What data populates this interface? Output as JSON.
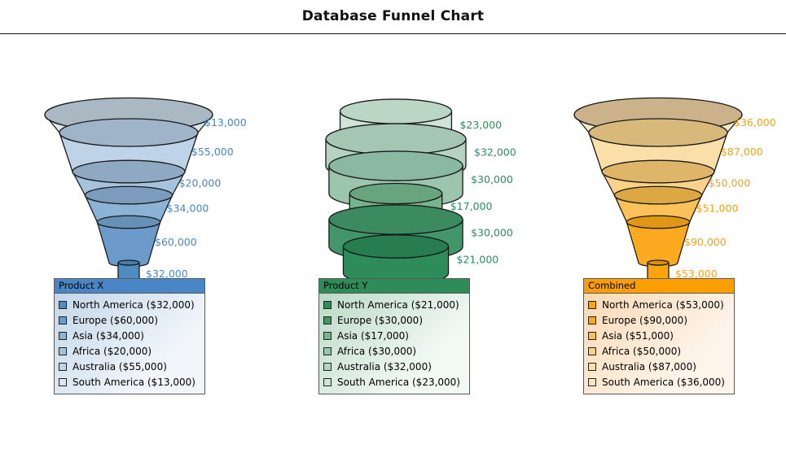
{
  "title": "Database Funnel Chart",
  "chart_data": [
    {
      "type": "funnel",
      "title": "Product X",
      "style": "cone",
      "accent": "#3a78b5",
      "categories": [
        "South America",
        "Australia",
        "Africa",
        "Asia",
        "Europe",
        "North America"
      ],
      "values": [
        13000,
        55000,
        20000,
        34000,
        60000,
        32000
      ],
      "labels": [
        "$13,000",
        "$55,000",
        "$20,000",
        "$34,000",
        "$60,000",
        "$32,000"
      ],
      "label_color": "#4a86c5",
      "segment_fills": [
        "#dbe6f1",
        "#bed3e8",
        "#a6c3de",
        "#8cb2d6",
        "#6c9bcb",
        "#4f8cc2"
      ],
      "segment_tops": [
        "#aab8c4",
        "#9fb4c9",
        "#8fa9c2",
        "#7b9cbc",
        "#6690b6",
        "#4a7fab"
      ]
    },
    {
      "type": "funnel",
      "title": "Product Y",
      "style": "cylinder-stack",
      "accent": "#3a8f62",
      "categories": [
        "South America",
        "Australia",
        "Africa",
        "Asia",
        "Europe",
        "North America"
      ],
      "values": [
        23000,
        32000,
        30000,
        17000,
        30000,
        21000
      ],
      "labels": [
        "$23,000",
        "$32,000",
        "$30,000",
        "$17,000",
        "$30,000",
        "$21,000"
      ],
      "label_color": "#2e8b62",
      "segment_fills": [
        "#cfe3d6",
        "#b5d3c0",
        "#9cc5ae",
        "#76b58c",
        "#43966a",
        "#2e8b5a"
      ],
      "segment_tops": [
        "#bcd6c6",
        "#a4c6b2",
        "#8ab8a0",
        "#68a57e",
        "#3b8a60",
        "#277c50"
      ]
    },
    {
      "type": "funnel",
      "title": "Combined",
      "style": "cone",
      "accent": "#f79a00",
      "categories": [
        "South America",
        "Australia",
        "Africa",
        "Asia",
        "Europe",
        "North America"
      ],
      "values": [
        36000,
        87000,
        50000,
        51000,
        90000,
        53000
      ],
      "labels": [
        "$36,000",
        "$87,000",
        "$50,000",
        "$51,000",
        "$90,000",
        "$53,000"
      ],
      "label_color": "#f2a21c",
      "segment_fills": [
        "#f7e7c6",
        "#fbdfa8",
        "#fcd28a",
        "#fcc158",
        "#fdaa20",
        "#fca40d"
      ],
      "segment_tops": [
        "#cbb28a",
        "#d9b87c",
        "#dfb669",
        "#dda743",
        "#e09716",
        "#dc900a"
      ]
    }
  ],
  "legends": [
    {
      "header": "Product X",
      "header_bg": "#4a86c5",
      "body_from": "#c3d6e9",
      "body_to": "#f2f6fa",
      "items": [
        {
          "label": "North America ($32,000)",
          "swatch": "#4f8cc2"
        },
        {
          "label": "Europe ($60,000)",
          "swatch": "#6c9bcb"
        },
        {
          "label": "Asia ($34,000)",
          "swatch": "#8cb2d6"
        },
        {
          "label": "Africa ($20,000)",
          "swatch": "#a6c3de"
        },
        {
          "label": "Australia ($55,000)",
          "swatch": "#bed3e8"
        },
        {
          "label": "South America ($13,000)",
          "swatch": "#dbe6f1"
        }
      ]
    },
    {
      "header": "Product Y",
      "header_bg": "#2e8b5a",
      "body_from": "#bcd9c6",
      "body_to": "#f2f9f4",
      "items": [
        {
          "label": "North America ($21,000)",
          "swatch": "#2e8b5a"
        },
        {
          "label": "Europe ($30,000)",
          "swatch": "#43966a"
        },
        {
          "label": "Asia ($17,000)",
          "swatch": "#76b58c"
        },
        {
          "label": "Africa ($30,000)",
          "swatch": "#9cc5ae"
        },
        {
          "label": "Australia ($32,000)",
          "swatch": "#b5d3c0"
        },
        {
          "label": "South America ($23,000)",
          "swatch": "#cfe3d6"
        }
      ]
    },
    {
      "header": "Combined",
      "header_bg": "#fb9e00",
      "body_from": "#fbd9b3",
      "body_to": "#fdf4ea",
      "items": [
        {
          "label": "North America ($53,000)",
          "swatch": "#fca40d"
        },
        {
          "label": "Europe ($90,000)",
          "swatch": "#fdaa20"
        },
        {
          "label": "Asia ($51,000)",
          "swatch": "#fcc158"
        },
        {
          "label": "Africa ($50,000)",
          "swatch": "#fcd28a"
        },
        {
          "label": "Australia ($87,000)",
          "swatch": "#fbdfa8"
        },
        {
          "label": "South America ($36,000)",
          "swatch": "#f7e7c6"
        }
      ]
    }
  ]
}
